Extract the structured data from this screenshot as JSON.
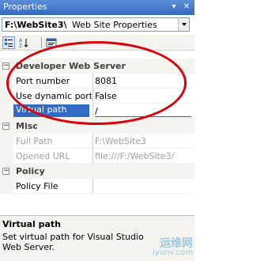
{
  "window": {
    "title": "Properties",
    "pin_glyph": "▾",
    "close_glyph": "✕"
  },
  "selector": {
    "object_name": "F:\\WebSite3\\",
    "object_type": "Web Site Properties"
  },
  "toolbar": {
    "tools": [
      "categorized-icon",
      "alphabetical-icon",
      "property-pages-icon"
    ]
  },
  "grid": {
    "categories": [
      {
        "name": "Developer Web Server",
        "properties": [
          {
            "name": "Port number",
            "value": "8081",
            "disabled": false
          },
          {
            "name": "Use dynamic ports",
            "value": "False",
            "disabled": false
          },
          {
            "name": "Virtual path",
            "value": "/",
            "disabled": false,
            "selected": true
          }
        ]
      },
      {
        "name": "Misc",
        "properties": [
          {
            "name": "Full Path",
            "value": "F:\\WebSite3",
            "disabled": true
          },
          {
            "name": "Opened URL",
            "value": "file:///F:/WebSite3/",
            "disabled": true
          }
        ]
      },
      {
        "name": "Policy",
        "properties": [
          {
            "name": "Policy File",
            "value": "",
            "disabled": false
          }
        ]
      }
    ]
  },
  "description": {
    "title": "Virtual path",
    "text": "Set virtual path for Visual Studio Web Server."
  },
  "watermark": {
    "line1": "运维网",
    "line2": "iyunv.com"
  },
  "colors": {
    "title_bar": "#3d74c9",
    "selection": "#316ac5",
    "annotation": "#d8000a"
  }
}
